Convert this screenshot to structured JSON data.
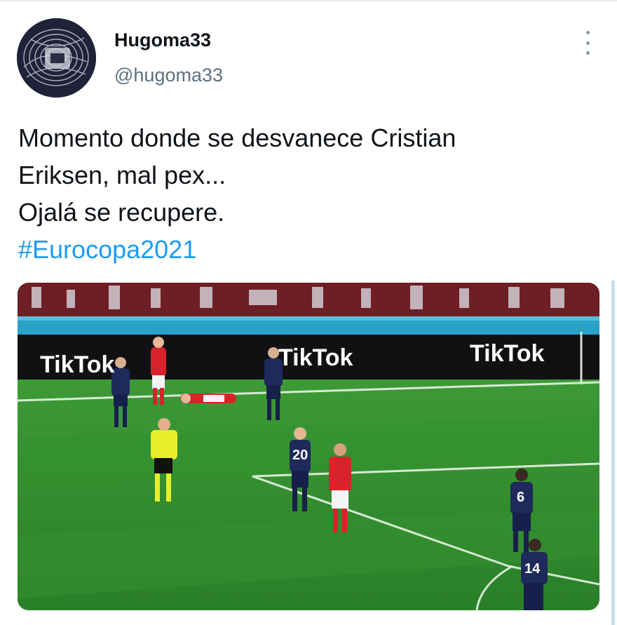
{
  "tweet": {
    "author": {
      "display_name": "Hugoma33",
      "handle": "@hugoma33"
    },
    "text_lines": [
      "Momento donde se desvanece Cristian",
      "Eriksen, mal pex...",
      "Ojalá se recupere."
    ],
    "hashtag": "#Eurocopa2021",
    "media": {
      "boards": [
        "TikTok",
        "TikTok",
        "TikTok"
      ],
      "jersey_numbers": [
        "20",
        "6",
        "14"
      ]
    }
  },
  "icons": {
    "more": "more-vertical-icon"
  },
  "colors": {
    "link": "#1d9bf0",
    "secondary_text": "#5b7083"
  }
}
